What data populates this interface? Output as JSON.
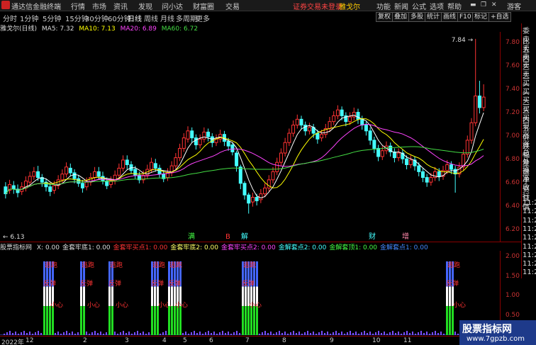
{
  "app": {
    "title": "通达信金融终端",
    "menu": [
      "行情",
      "市场",
      "资讯",
      "发现",
      "问小达",
      "财富圈",
      "交易"
    ],
    "login_status": "证券交易未登录",
    "stock_name": "雅戈尔",
    "right_menu": [
      "功能",
      "新闻",
      "公式",
      "选项",
      "帮助"
    ],
    "user": "游客"
  },
  "timeframes": {
    "items": [
      "分时",
      "1分钟",
      "5分钟",
      "15分钟",
      "30分钟",
      "60分钟",
      "日线",
      "周线",
      "月线",
      "多周期",
      "更多"
    ],
    "active": "日线"
  },
  "toolbar_right": [
    "复权",
    "叠加",
    "多股",
    "统计",
    "画线",
    "F10",
    "标记",
    "+自选"
  ],
  "chart_header": {
    "title": "雅戈尔(日线)",
    "ma5": "MA5: 7.32",
    "ma10": "MA10: 7.13",
    "ma20": "MA20: 6.89",
    "ma60": "MA60: 6.72",
    "colors": {
      "ma5": "#ffffff",
      "ma10": "#ffff00",
      "ma20": "#ff44ff",
      "ma60": "#44dd44"
    }
  },
  "price_axis": [
    "7.80",
    "7.60",
    "7.40",
    "7.20",
    "7.00",
    "6.80",
    "6.60",
    "6.40",
    "6.20"
  ],
  "high_label": "7.84",
  "low_label": "6.13",
  "candles": [
    [
      6.57,
      6.51,
      6.61,
      6.47
    ],
    [
      6.54,
      6.59,
      6.63,
      6.51
    ],
    [
      6.58,
      6.55,
      6.62,
      6.51
    ],
    [
      6.55,
      6.52,
      6.59,
      6.48
    ],
    [
      6.53,
      6.57,
      6.61,
      6.5
    ],
    [
      6.56,
      6.62,
      6.66,
      6.53
    ],
    [
      6.61,
      6.66,
      6.7,
      6.58
    ],
    [
      6.66,
      6.7,
      6.74,
      6.63
    ],
    [
      6.7,
      6.65,
      6.75,
      6.62
    ],
    [
      6.65,
      6.61,
      6.68,
      6.57
    ],
    [
      6.61,
      6.57,
      6.64,
      6.53
    ],
    [
      6.57,
      6.53,
      6.6,
      6.49
    ],
    [
      6.54,
      6.58,
      6.62,
      6.51
    ],
    [
      6.58,
      6.63,
      6.67,
      6.55
    ],
    [
      6.63,
      6.68,
      6.72,
      6.6
    ],
    [
      6.68,
      6.74,
      6.78,
      6.65
    ],
    [
      6.73,
      6.69,
      6.77,
      6.66
    ],
    [
      6.69,
      6.64,
      6.72,
      6.6
    ],
    [
      6.64,
      6.6,
      6.67,
      6.57
    ],
    [
      6.6,
      6.56,
      6.63,
      6.52
    ],
    [
      6.57,
      6.61,
      6.65,
      6.54
    ],
    [
      6.61,
      6.65,
      6.69,
      6.58
    ],
    [
      6.65,
      6.7,
      6.74,
      6.62
    ],
    [
      6.7,
      6.66,
      6.74,
      6.63
    ],
    [
      6.66,
      6.62,
      6.7,
      6.59
    ],
    [
      6.62,
      6.58,
      6.65,
      6.55
    ],
    [
      6.59,
      6.62,
      6.66,
      6.56
    ],
    [
      6.62,
      6.67,
      6.71,
      6.59
    ],
    [
      6.67,
      6.73,
      6.77,
      6.64
    ],
    [
      6.73,
      6.8,
      6.84,
      6.7
    ],
    [
      6.8,
      6.76,
      6.84,
      6.72
    ],
    [
      6.76,
      6.71,
      6.79,
      6.68
    ],
    [
      6.72,
      6.67,
      6.75,
      6.64
    ],
    [
      6.67,
      6.63,
      6.7,
      6.6
    ],
    [
      6.63,
      6.67,
      6.71,
      6.6
    ],
    [
      6.67,
      6.72,
      6.76,
      6.64
    ],
    [
      6.72,
      6.78,
      6.82,
      6.69
    ],
    [
      6.77,
      6.73,
      6.81,
      6.7
    ],
    [
      6.73,
      6.68,
      6.76,
      6.65
    ],
    [
      6.68,
      6.64,
      6.71,
      6.61
    ],
    [
      6.65,
      6.69,
      6.73,
      6.62
    ],
    [
      6.69,
      6.75,
      6.79,
      6.66
    ],
    [
      6.75,
      6.82,
      6.86,
      6.72
    ],
    [
      6.82,
      6.9,
      6.94,
      6.79
    ],
    [
      6.9,
      6.99,
      7.03,
      6.87
    ],
    [
      6.98,
      7.05,
      7.09,
      6.95
    ],
    [
      7.05,
      6.99,
      7.08,
      6.95
    ],
    [
      6.99,
      6.93,
      7.02,
      6.89
    ],
    [
      6.93,
      6.98,
      7.02,
      6.9
    ],
    [
      6.98,
      7.04,
      7.08,
      6.95
    ],
    [
      7.04,
      7.0,
      7.07,
      6.96
    ],
    [
      7.0,
      6.95,
      7.03,
      6.91
    ],
    [
      6.95,
      6.98,
      7.02,
      6.92
    ],
    [
      6.98,
      7.02,
      7.06,
      6.95
    ],
    [
      7.02,
      6.96,
      7.05,
      6.92
    ],
    [
      6.96,
      6.92,
      6.99,
      6.88
    ],
    [
      6.93,
      6.87,
      6.95,
      6.84
    ],
    [
      6.86,
      6.75,
      6.88,
      6.7
    ],
    [
      6.74,
      6.6,
      6.76,
      6.55
    ],
    [
      6.6,
      6.5,
      6.62,
      6.46
    ],
    [
      6.5,
      6.43,
      6.52,
      6.34
    ],
    [
      6.44,
      6.48,
      6.52,
      6.4
    ],
    [
      6.48,
      6.45,
      6.51,
      6.41
    ],
    [
      6.46,
      6.51,
      6.55,
      6.43
    ],
    [
      6.51,
      6.56,
      6.6,
      6.48
    ],
    [
      6.56,
      6.63,
      6.67,
      6.53
    ],
    [
      6.63,
      6.7,
      6.74,
      6.6
    ],
    [
      6.7,
      6.78,
      6.82,
      6.67
    ],
    [
      6.78,
      6.86,
      6.9,
      6.75
    ],
    [
      6.86,
      6.95,
      6.99,
      6.83
    ],
    [
      6.95,
      7.03,
      7.07,
      6.92
    ],
    [
      7.03,
      7.1,
      7.14,
      7.0
    ],
    [
      7.1,
      7.15,
      7.19,
      7.07
    ],
    [
      7.15,
      7.1,
      7.18,
      7.06
    ],
    [
      7.1,
      7.05,
      7.13,
      7.01
    ],
    [
      7.05,
      7.08,
      7.12,
      7.02
    ],
    [
      7.08,
      7.03,
      7.11,
      6.99
    ],
    [
      7.03,
      6.98,
      7.06,
      6.94
    ],
    [
      6.99,
      7.02,
      7.06,
      6.96
    ],
    [
      7.02,
      7.07,
      7.11,
      6.99
    ],
    [
      7.07,
      7.13,
      7.17,
      7.04
    ],
    [
      7.13,
      7.18,
      7.22,
      7.1
    ],
    [
      7.18,
      7.23,
      7.27,
      7.15
    ],
    [
      7.23,
      7.18,
      7.26,
      7.14
    ],
    [
      7.18,
      7.13,
      7.21,
      7.09
    ],
    [
      7.13,
      7.17,
      7.21,
      7.1
    ],
    [
      7.17,
      7.21,
      7.25,
      7.14
    ],
    [
      7.21,
      7.15,
      7.24,
      7.11
    ],
    [
      7.15,
      7.1,
      7.18,
      7.06
    ],
    [
      7.1,
      7.05,
      7.13,
      7.01
    ],
    [
      7.05,
      6.97,
      7.08,
      6.93
    ],
    [
      6.97,
      6.9,
      7.0,
      6.86
    ],
    [
      6.9,
      6.83,
      6.93,
      6.79
    ],
    [
      6.83,
      6.88,
      6.92,
      6.8
    ],
    [
      6.88,
      6.92,
      6.96,
      6.85
    ],
    [
      6.92,
      6.87,
      6.95,
      6.83
    ],
    [
      6.87,
      6.82,
      6.9,
      6.78
    ],
    [
      6.82,
      6.86,
      6.9,
      6.79
    ],
    [
      6.86,
      6.81,
      6.89,
      6.77
    ],
    [
      6.81,
      6.76,
      6.84,
      6.72
    ],
    [
      6.76,
      6.8,
      6.84,
      6.73
    ],
    [
      6.8,
      6.75,
      6.83,
      6.71
    ],
    [
      6.75,
      6.7,
      6.78,
      6.66
    ],
    [
      6.7,
      6.65,
      6.73,
      6.61
    ],
    [
      6.65,
      6.61,
      6.68,
      6.57
    ],
    [
      6.61,
      6.65,
      6.69,
      6.58
    ],
    [
      6.65,
      6.7,
      6.74,
      6.62
    ],
    [
      6.7,
      6.66,
      6.73,
      6.62
    ],
    [
      6.66,
      6.71,
      6.75,
      6.63
    ],
    [
      6.71,
      6.76,
      6.8,
      6.68
    ],
    [
      6.76,
      6.72,
      6.79,
      6.68
    ],
    [
      6.72,
      6.68,
      6.75,
      6.52
    ],
    [
      6.68,
      6.74,
      6.78,
      6.65
    ],
    [
      6.74,
      6.85,
      6.89,
      6.71
    ],
    [
      6.85,
      6.97,
      7.01,
      6.82
    ],
    [
      6.97,
      7.12,
      7.16,
      6.94
    ],
    [
      7.12,
      7.35,
      7.84,
      7.09
    ],
    [
      7.35,
      7.25,
      7.48,
      7.2
    ],
    [
      7.25,
      7.34,
      7.45,
      7.22
    ]
  ],
  "indicator_header": {
    "name": "股票指标网",
    "items": [
      {
        "text": "X: 0.00",
        "color": "#dddddd"
      },
      {
        "text": "金套牢底1: 0.00",
        "color": "#dddddd"
      },
      {
        "text": "金套牢买点1: 0.00",
        "color": "#ff3333"
      },
      {
        "text": "金套牢底2: 0.00",
        "color": "#ffff66"
      },
      {
        "text": "金套牢买点2: 0.00",
        "color": "#ff44ff"
      },
      {
        "text": "金解套点2: 0.00",
        "color": "#44ffff"
      },
      {
        "text": "金解套顶1: 0.00",
        "color": "#44ff44"
      },
      {
        "text": "金解套点1: 0.00",
        "color": "#4488ff"
      }
    ]
  },
  "chart_markers": [
    {
      "text": "满",
      "color": "#44ff44"
    },
    {
      "text": "B",
      "color": "#ff3333"
    },
    {
      "text": "解",
      "color": "#44ffff"
    },
    {
      "text": "财",
      "color": "#44ffff"
    },
    {
      "text": "增",
      "color": "#ff88aa"
    }
  ],
  "sub_labels": {
    "escape": "逃跑",
    "rebound": "反弹",
    "careful": "小心"
  },
  "sub_axis": [
    "2.00",
    "1.50",
    "1.00",
    "0.50"
  ],
  "date_axis": [
    "2022年",
    "12",
    "2",
    "3",
    "4",
    "5",
    "6",
    "7",
    "8",
    "9",
    "10",
    "11"
  ],
  "right_panel": [
    "委比",
    "卖五",
    "卖四",
    "卖三",
    "卖二",
    "卖一",
    "买一",
    "买二",
    "买三",
    "买四",
    "买五",
    "现价",
    "涨跌",
    "涨幅",
    "总量",
    "外盘",
    "换手",
    "净资",
    "收益",
    "行情",
    "11:25",
    "11:25",
    "11:25",
    "11:25",
    "11:25",
    "11:25",
    "11:25",
    "11:25",
    "11:25"
  ],
  "watermark": {
    "title": "股票指标网",
    "url": "www.7gpzb.com"
  }
}
